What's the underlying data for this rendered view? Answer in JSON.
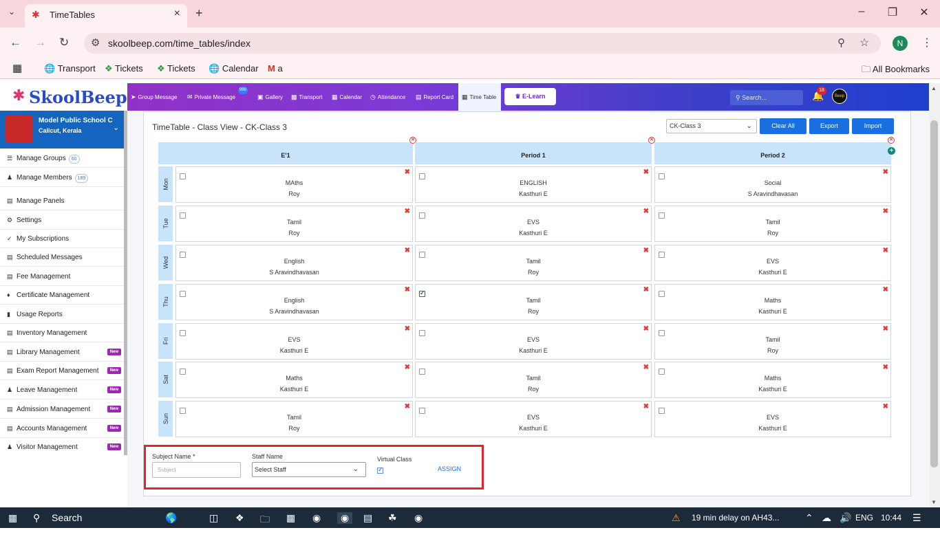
{
  "browser": {
    "tab_title": "TimeTables",
    "url": "skoolbeep.com/time_tables/index",
    "profile_initial": "N",
    "bookmarks": [
      "Transport",
      "Tickets",
      "Tickets",
      "Calendar",
      "a"
    ],
    "all_bookmarks": "All Bookmarks"
  },
  "app": {
    "logo_text": "SkoolBeep",
    "nav": [
      "Group Message",
      "Private Message",
      "Gallery",
      "Transport",
      "Calendar",
      "Attendance",
      "Report Card",
      "Time Table"
    ],
    "private_badge": "999",
    "elearn": "E-Learn",
    "search_placeholder": "Search...",
    "notif_count": "18",
    "user_avatar": "Beep"
  },
  "school": {
    "name": "Model Public School C",
    "city": "Calicut, Kerala"
  },
  "sidebar": {
    "items": [
      {
        "label": "Manage Groups",
        "count": "60"
      },
      {
        "label": "Manage Members",
        "count": "189"
      },
      {
        "label": "Manage Panels"
      },
      {
        "label": "Settings"
      },
      {
        "label": "My Subscriptions"
      },
      {
        "label": "Scheduled Messages"
      },
      {
        "label": "Fee Management"
      },
      {
        "label": "Certificate Management"
      },
      {
        "label": "Usage Reports"
      },
      {
        "label": "Inventory Management"
      },
      {
        "label": "Library Management",
        "new": "New"
      },
      {
        "label": "Exam Report Management",
        "new": "New"
      },
      {
        "label": "Leave Management",
        "new": "New"
      },
      {
        "label": "Admission Management",
        "new": "New"
      },
      {
        "label": "Accounts Management",
        "new": "New"
      },
      {
        "label": "Visitor Management",
        "new": "New"
      }
    ]
  },
  "timetable": {
    "title": "TimeTable - Class View - CK-Class 3",
    "class_select": "CK-Class 3",
    "buttons": {
      "clear": "Clear All",
      "export": "Export",
      "import": "Import"
    },
    "columns": [
      "E'1",
      "Period 1",
      "Period 2"
    ],
    "rows": [
      {
        "day": "Mon",
        "cells": [
          {
            "s": "MAths",
            "t": "Roy"
          },
          {
            "s": "ENGLISH",
            "t": "Kasthuri E"
          },
          {
            "s": "Social",
            "t": "S Aravindhavasan"
          }
        ]
      },
      {
        "day": "Tue",
        "cells": [
          {
            "s": "Tamil",
            "t": "Roy"
          },
          {
            "s": "EVS",
            "t": "Kasthuri E"
          },
          {
            "s": "Tamil",
            "t": "Roy"
          }
        ]
      },
      {
        "day": "Wed",
        "cells": [
          {
            "s": "English",
            "t": "S Aravindhavasan"
          },
          {
            "s": "Tamil",
            "t": "Roy"
          },
          {
            "s": "EVS",
            "t": "Kasthuri E"
          }
        ]
      },
      {
        "day": "Thu",
        "cells": [
          {
            "s": "English",
            "t": "S Aravindhavasan"
          },
          {
            "s": "Tamil",
            "t": "Roy",
            "checked": true
          },
          {
            "s": "Maths",
            "t": "Kasthuri E"
          }
        ]
      },
      {
        "day": "Fri",
        "cells": [
          {
            "s": "EVS",
            "t": "Kasthuri E"
          },
          {
            "s": "EVS",
            "t": "Kasthuri E"
          },
          {
            "s": "Tamil",
            "t": "Roy"
          }
        ]
      },
      {
        "day": "Sat",
        "cells": [
          {
            "s": "Maths",
            "t": "Kasthuri E"
          },
          {
            "s": "Tamil",
            "t": "Roy"
          },
          {
            "s": "Maths",
            "t": "Kasthuri E"
          }
        ]
      },
      {
        "day": "Sun",
        "cells": [
          {
            "s": "Tamil",
            "t": "Roy"
          },
          {
            "s": "EVS",
            "t": "Kasthuri E"
          },
          {
            "s": "EVS",
            "t": "Kasthuri E"
          }
        ]
      }
    ]
  },
  "form": {
    "subject_label": "Subject Name *",
    "subject_placeholder": "Subject",
    "staff_label": "Staff Name",
    "staff_value": "Select Staff",
    "virtual_label": "Virtual Class",
    "assign": "ASSIGN"
  },
  "taskbar": {
    "search": "Search",
    "news": "19 min delay on AH43...",
    "lang": "ENG",
    "time": "10:44"
  }
}
